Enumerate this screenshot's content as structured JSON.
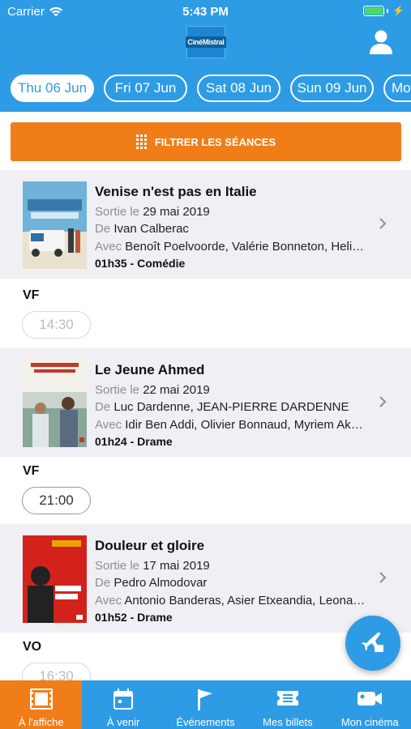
{
  "status_bar": {
    "carrier": "Carrier",
    "time": "5:43 PM"
  },
  "header": {
    "logo_text": "CinéMistral"
  },
  "date_tabs": [
    {
      "label": "Thu 06 Jun",
      "active": true
    },
    {
      "label": "Fri 07 Jun",
      "active": false
    },
    {
      "label": "Sat 08 Jun",
      "active": false
    },
    {
      "label": "Sun 09 Jun",
      "active": false
    },
    {
      "label": "Mon",
      "active": false
    }
  ],
  "filter": {
    "label": "FILTRER LES SÉANCES"
  },
  "movies": [
    {
      "title": "Venise n'est pas en Italie",
      "release_prefix": "Sortie le",
      "release_date": "29 mai 2019",
      "director_prefix": "De",
      "director": "Ivan Calberac",
      "cast_prefix": "Avec",
      "cast": "Benoît Poelvoorde, Valérie Bonneton, Heli…",
      "meta": "01h35 - Comédie",
      "poster_colors": [
        "#6fb3d8",
        "#e8e2cf",
        "#2f6ea3"
      ],
      "version": "VF",
      "showtimes": [
        {
          "time": "14:30",
          "past": true
        }
      ]
    },
    {
      "title": "Le Jeune Ahmed",
      "release_prefix": "Sortie le",
      "release_date": "22 mai 2019",
      "director_prefix": "De",
      "director": "Luc Dardenne, JEAN-PIERRE DARDENNE",
      "cast_prefix": "Avec",
      "cast": "Idir Ben Addi, Olivier Bonnaud, Myriem Ak…",
      "meta": "01h24 - Drame",
      "poster_colors": [
        "#f4f1ea",
        "#8aa59a",
        "#c0392b"
      ],
      "version": "VF",
      "showtimes": [
        {
          "time": "21:00",
          "past": false
        }
      ]
    },
    {
      "title": "Douleur et gloire",
      "release_prefix": "Sortie le",
      "release_date": "17 mai 2019",
      "director_prefix": "De",
      "director": "Pedro Almodovar",
      "cast_prefix": "Avec",
      "cast": "Antonio Banderas, Asier Etxeandia, Leona…",
      "meta": "01h52 - Drame",
      "poster_colors": [
        "#d3221c",
        "#f2c300",
        "#222222"
      ],
      "version": "VO",
      "showtimes": [
        {
          "time": "16:30",
          "past": true
        }
      ]
    }
  ],
  "tab_bar": [
    {
      "label": "À l'affiche",
      "icon": "film-icon",
      "active": true
    },
    {
      "label": "À venir",
      "icon": "calendar-icon",
      "active": false
    },
    {
      "label": "Événements",
      "icon": "flag-icon",
      "active": false
    },
    {
      "label": "Mes billets",
      "icon": "ticket-icon",
      "active": false
    },
    {
      "label": "Mon cinéma",
      "icon": "camera-icon",
      "active": false
    }
  ],
  "colors": {
    "primary": "#2e9be5",
    "accent": "#f07d18",
    "card": "#efeff4"
  }
}
